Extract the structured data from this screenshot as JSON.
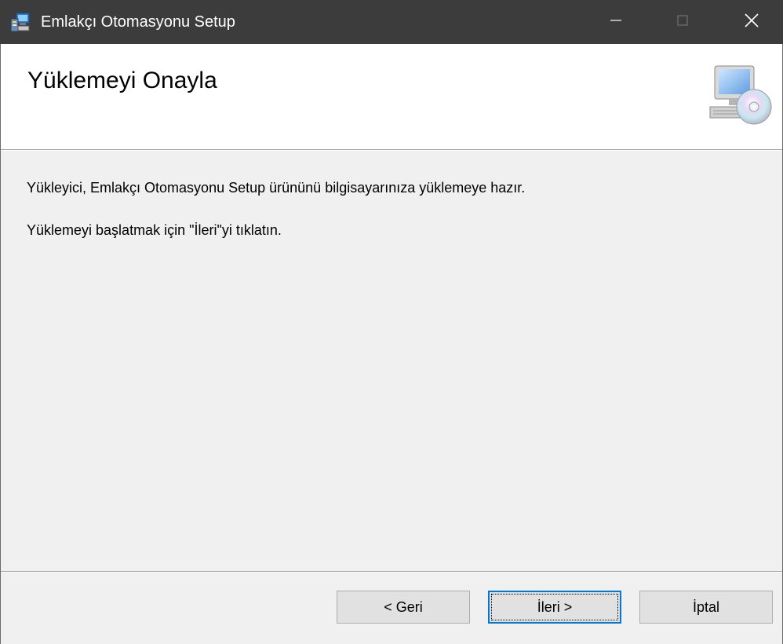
{
  "window": {
    "title": "Emlakçı Otomasyonu Setup",
    "icons": {
      "app": "installer-icon",
      "minimize": "minimize-icon",
      "maximize": "maximize-icon",
      "close": "close-icon"
    },
    "colors": {
      "titlebar_bg": "#3c3c3c",
      "titlebar_fg": "#ffffff",
      "accent": "#0078d7"
    }
  },
  "header": {
    "title": "Yüklemeyi Onayla",
    "icon": "computer-cd-icon"
  },
  "body": {
    "line1": "Yükleyici, Emlakçı Otomasyonu Setup ürününü bilgisayarınıza yüklemeye hazır.",
    "line2": "Yüklemeyi başlatmak için \"İleri\"yi tıklatın."
  },
  "buttons": {
    "back": "< Geri",
    "next": "İleri >",
    "cancel": "İptal"
  }
}
